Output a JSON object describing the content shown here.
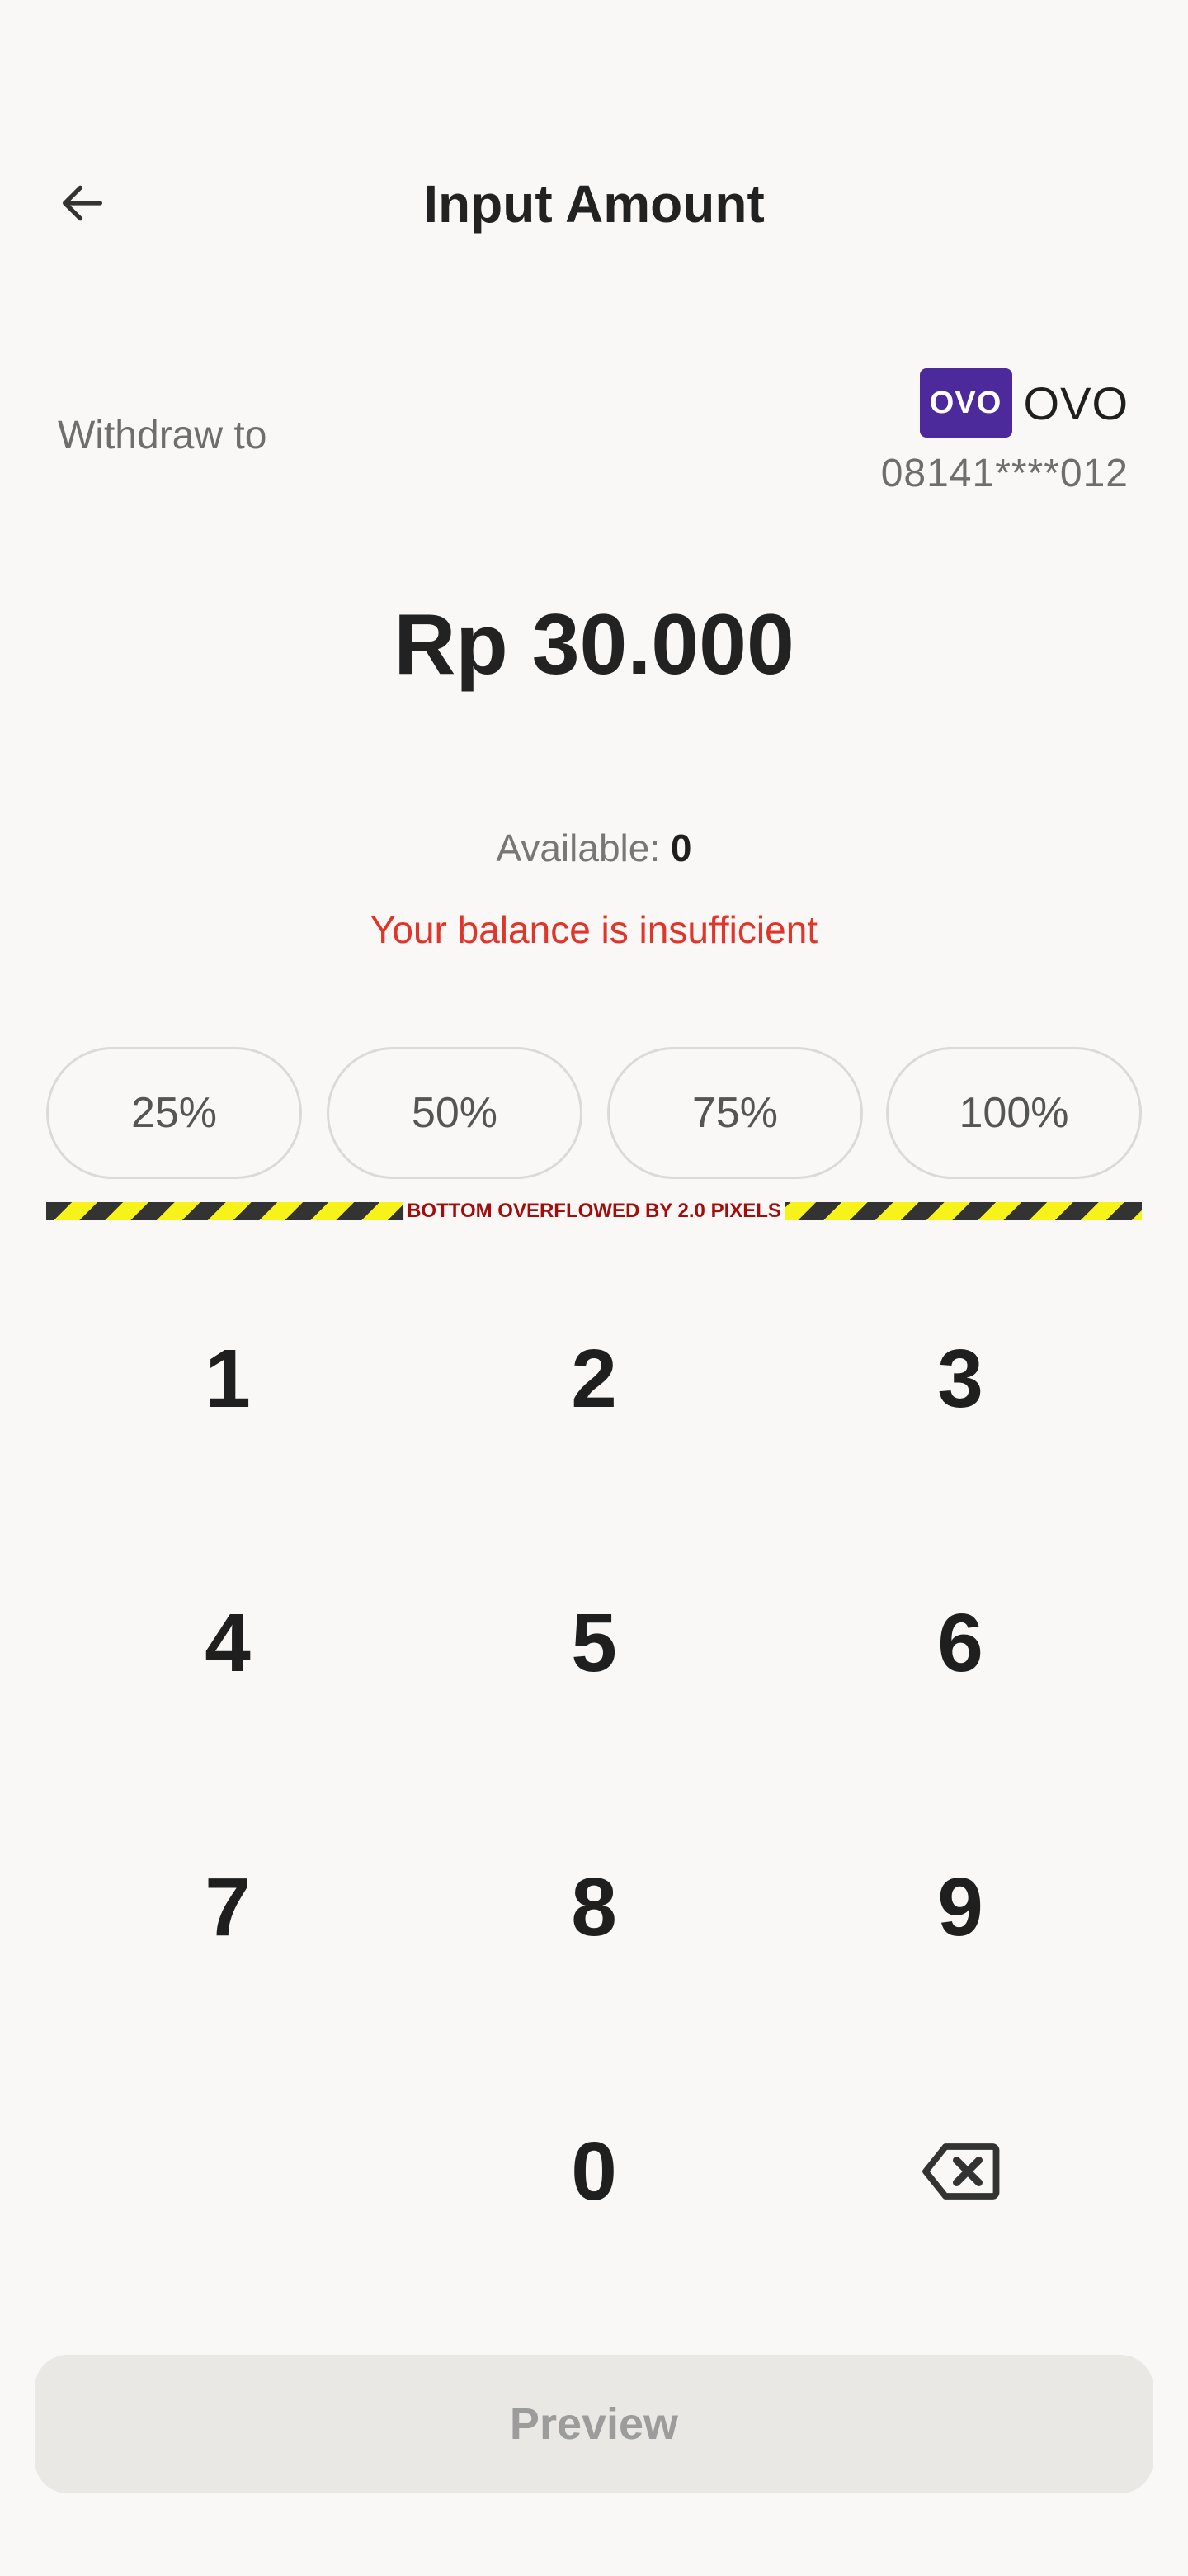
{
  "header": {
    "title": "Input Amount",
    "back_icon": "arrow-left-icon"
  },
  "withdraw": {
    "label": "Withdraw to",
    "brand_logo_text": "OVO",
    "brand_name": "OVO",
    "account_number": "08141****012",
    "brand_color": "#4c2a9c"
  },
  "amount": {
    "display": "Rp 30.000"
  },
  "balance": {
    "available_label": "Available:",
    "available_value": "0",
    "error": "Your balance is insufficient",
    "error_color": "#e0352b"
  },
  "chips": [
    "25%",
    "50%",
    "75%",
    "100%"
  ],
  "overflow_warning": "BOTTOM OVERFLOWED BY 2.0 PIXELS",
  "keypad": {
    "keys": [
      "1",
      "2",
      "3",
      "4",
      "5",
      "6",
      "7",
      "8",
      "9",
      "0"
    ],
    "backspace_icon": "backspace-icon"
  },
  "preview_button": {
    "label": "Preview"
  }
}
